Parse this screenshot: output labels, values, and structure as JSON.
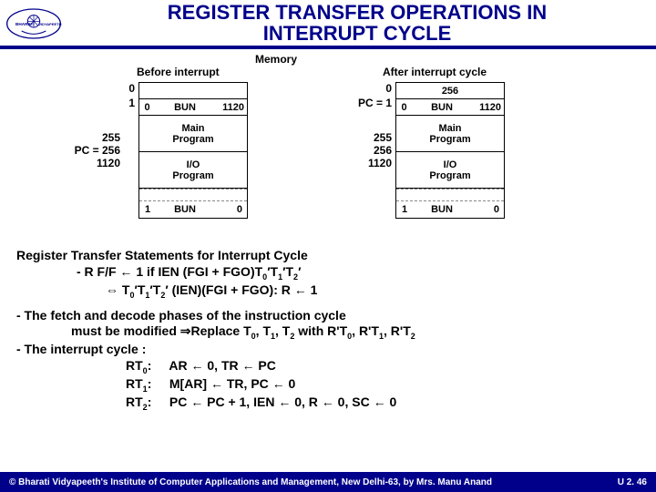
{
  "header": {
    "title_line1": "REGISTER  TRANSFER  OPERATIONS  IN",
    "title_line2": "INTERRUPT CYCLE"
  },
  "diagram": {
    "memory_label": "Memory",
    "before_label": "Before interrupt",
    "after_label": "After interrupt cycle",
    "before": {
      "addr0": "0",
      "addr1": "1",
      "row1_c1": "0",
      "row1_c2": "BUN",
      "row1_c3": "1120",
      "addr255": "255",
      "pc_label": "PC = 256",
      "addr1120": "1120",
      "seg1": "Main\nProgram",
      "seg2": "I/O\nProgram",
      "last_c1": "1",
      "last_c2": "BUN",
      "last_c3": "0"
    },
    "after": {
      "addr0": "0",
      "pc_label": "PC = 1",
      "row0_val": "256",
      "row1_c1": "0",
      "row1_c2": "BUN",
      "row1_c3": "1120",
      "addr255": "255",
      "addr256": "256",
      "addr1120": "1120",
      "seg1": "Main\nProgram",
      "seg2": "I/O\nProgram",
      "last_c1": "1",
      "last_c2": "BUN",
      "last_c3": "0"
    }
  },
  "text": {
    "heading": "Register Transfer Statements for Interrupt Cycle",
    "line1_a": "- R  F/F ← 1      if IEN (FGI + FGO)T",
    "line1_b": "′T",
    "line1_c": "′T",
    "line1_d": "′",
    "line2_a": "⇔ T",
    "line2_b": "′T",
    "line2_c": "′T",
    "line2_d": "′ (IEN)(FGI + FGO):   R  ← 1",
    "line3": "- The fetch and decode phases of the instruction cycle",
    "line4_a": "must be modified ⇒Replace T",
    "line4_b": ", T",
    "line4_c": ", T",
    "line4_d": "  with  R'T",
    "line4_e": ", R'T",
    "line4_f": ", R'T",
    "line5": "- The interrupt cycle :",
    "rt0_lbl": "RT",
    "rt0_col": ":",
    "rt0_body": "AR ← 0,  TR ← PC",
    "rt1_body": "M[AR] ← TR,  PC ← 0",
    "rt2_body": "PC ← PC + 1,  IEN ← 0,  R ← 0,  SC ← 0"
  },
  "footer": {
    "copyright": "© Bharati Vidyapeeth's Institute of Computer Applications and Management, New Delhi-63, by Mrs. Manu Anand",
    "page": "U 2. 46"
  }
}
